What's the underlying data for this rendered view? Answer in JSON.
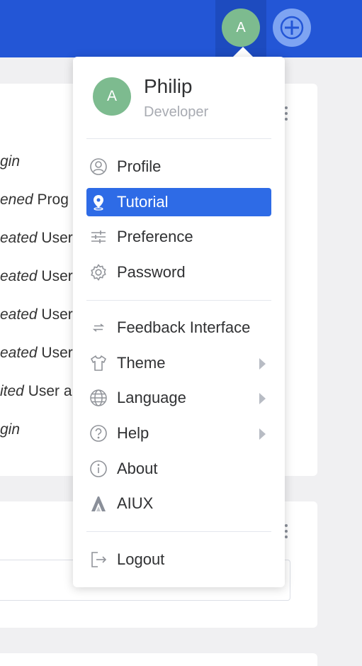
{
  "header": {
    "user_initial": "A"
  },
  "background_activities": [
    {
      "italic": "gin",
      "rest": ""
    },
    {
      "italic": "ened",
      "rest": " Prog"
    },
    {
      "italic": "eated",
      "rest": " User"
    },
    {
      "italic": "eated",
      "rest": " User"
    },
    {
      "italic": "eated",
      "rest": " User"
    },
    {
      "italic": "eated",
      "rest": " User"
    },
    {
      "italic": "ited",
      "rest": " User a"
    },
    {
      "italic": "gin",
      "rest": ""
    }
  ],
  "user_menu": {
    "avatar_initial": "A",
    "name": "Philip",
    "role": "Developer",
    "items": [
      {
        "label": "Profile",
        "icon": "user-circle-icon"
      },
      {
        "label": "Tutorial",
        "icon": "location-pin-icon",
        "active": true
      },
      {
        "label": "Preference",
        "icon": "sliders-icon"
      },
      {
        "label": "Password",
        "icon": "gear-icon"
      },
      {
        "label": "Feedback Interface",
        "icon": "swap-arrows-icon"
      },
      {
        "label": "Theme",
        "icon": "tshirt-icon",
        "submenu": true
      },
      {
        "label": "Language",
        "icon": "globe-icon",
        "submenu": true
      },
      {
        "label": "Help",
        "icon": "question-circle-icon",
        "submenu": true
      },
      {
        "label": "About",
        "icon": "info-circle-icon"
      },
      {
        "label": "AIUX",
        "icon": "aiux-logo-icon"
      },
      {
        "label": "Logout",
        "icon": "logout-icon"
      }
    ]
  },
  "colors": {
    "topbar": "#2356d6",
    "active_item": "#2e6be6",
    "avatar": "#7dbb8f"
  }
}
